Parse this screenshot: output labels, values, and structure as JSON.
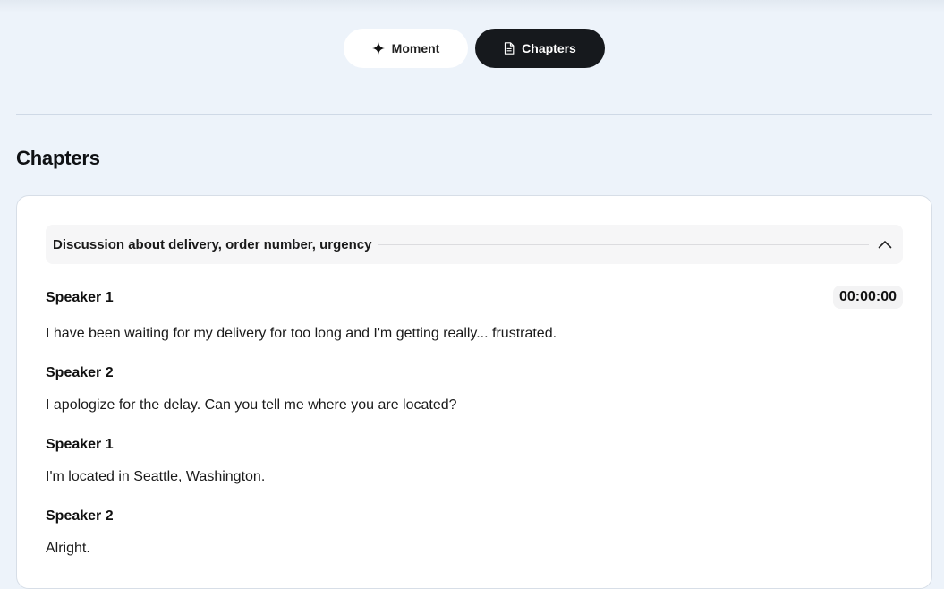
{
  "toggle": {
    "moment_label": "Moment",
    "chapters_label": "Chapters",
    "moment_icon": "sparkle-icon",
    "chapters_icon": "document-icon",
    "active_color": "#16191d"
  },
  "section": {
    "title": "Chapters"
  },
  "chapter": {
    "title": "Discussion about delivery, order number, urgency",
    "timestamp": "00:00:00",
    "expanded": true,
    "entries": [
      {
        "speaker": "Speaker 1",
        "text": "I have been waiting for my delivery for too long and I'm getting really... frustrated."
      },
      {
        "speaker": "Speaker 2",
        "text": "I apologize for the delay. Can you tell me where you are located?"
      },
      {
        "speaker": "Speaker 1",
        "text": "I'm located in Seattle, Washington."
      },
      {
        "speaker": "Speaker 2",
        "text": "Alright."
      }
    ]
  }
}
